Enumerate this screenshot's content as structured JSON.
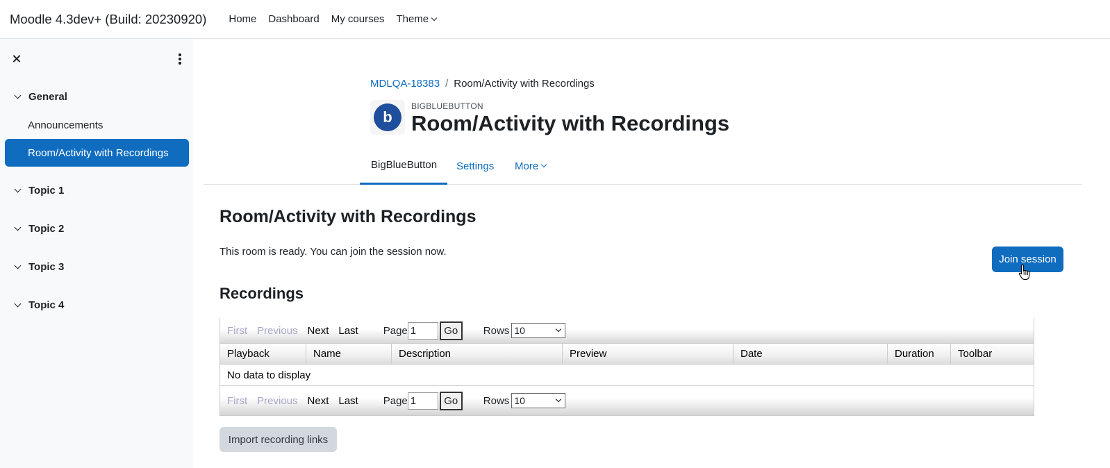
{
  "navbar": {
    "brand": "Moodle 4.3dev+ (Build: 20230920)",
    "links": [
      "Home",
      "Dashboard",
      "My courses",
      "Theme"
    ]
  },
  "drawer": {
    "sections": [
      {
        "label": "General",
        "items": [
          "Announcements",
          "Room/Activity with Recordings"
        ]
      },
      {
        "label": "Topic 1"
      },
      {
        "label": "Topic 2"
      },
      {
        "label": "Topic 3"
      },
      {
        "label": "Topic 4"
      }
    ],
    "active_item": "Room/Activity with Recordings"
  },
  "header": {
    "breadcrumb": [
      "MDLQA-18383",
      "/",
      "Room/Activity with Recordings"
    ],
    "icon_letter": "b",
    "modname": "BIGBLUEBUTTON",
    "title": "Room/Activity with Recordings"
  },
  "secondary_nav": {
    "tabs": [
      "BigBlueButton",
      "Settings",
      "More"
    ],
    "active": "BigBlueButton"
  },
  "main": {
    "heading": "Room/Activity with Recordings",
    "status": "This room is ready. You can join the session now.",
    "join_button": "Join session",
    "recordings_heading": "Recordings",
    "import_button": "Import recording links"
  },
  "recordings": {
    "paginator": {
      "first": "First",
      "previous": "Previous",
      "next": "Next",
      "last": "Last",
      "page_label": "Page",
      "page_value": "1",
      "go": "Go",
      "rows_label": "Rows",
      "rows_value": "10"
    },
    "columns": [
      "Playback",
      "Name",
      "Description",
      "Preview",
      "Date",
      "Duration",
      "Toolbar"
    ],
    "empty_message": "No data to display"
  }
}
